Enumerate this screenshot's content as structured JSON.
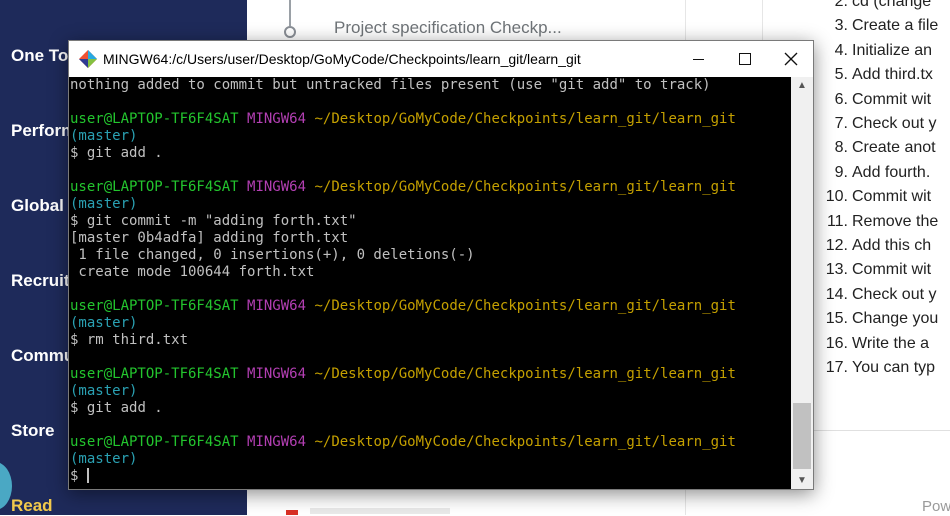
{
  "background_page": {
    "sidebar": {
      "items": [
        {
          "label": "One To"
        },
        {
          "label": "Perform"
        },
        {
          "label": "Global I"
        },
        {
          "label": "Recruite"
        },
        {
          "label": "Commu"
        },
        {
          "label": "Store"
        },
        {
          "label": "Read"
        }
      ]
    },
    "timeline": {
      "current_item": "Project specification Checkp..."
    },
    "instructions": [
      {
        "num": "2.",
        "text": "cd (change"
      },
      {
        "num": "3.",
        "text": "Create a file"
      },
      {
        "num": "4.",
        "text": "Initialize an"
      },
      {
        "num": "5.",
        "text": "Add third.tx"
      },
      {
        "num": "6.",
        "text": "Commit wit"
      },
      {
        "num": "7.",
        "text": "Check out y"
      },
      {
        "num": "8.",
        "text": "Create anot"
      },
      {
        "num": "9.",
        "text": "Add fourth."
      },
      {
        "num": "10.",
        "text": "Commit wit"
      },
      {
        "num": "11.",
        "text": "Remove the"
      },
      {
        "num": "12.",
        "text": "Add this ch"
      },
      {
        "num": "13.",
        "text": "Commit wit"
      },
      {
        "num": "14.",
        "text": "Check out y"
      },
      {
        "num": "15.",
        "text": "Change you"
      },
      {
        "num": "16.",
        "text": "Write the a"
      },
      {
        "num": "17.",
        "text": "You can typ"
      }
    ],
    "footer": {
      "powered": "Pow"
    }
  },
  "window": {
    "title": "MINGW64:/c/Users/user/Desktop/GoMyCode/Checkpoints/learn_git/learn_git",
    "icon": "git-bash-icon",
    "controls": {
      "minimize": "minimize-icon",
      "maximize": "maximize-icon",
      "close": "close-icon"
    }
  },
  "prompt": {
    "user": "user@LAPTOP-TF6F4SAT",
    "env": "MINGW64",
    "path": "~/Desktop/GoMyCode/Checkpoints/learn_git/learn_git",
    "branch": "(master)",
    "symbol": "$"
  },
  "terminal_lines": {
    "l0": "nothing added to commit but untracked files present (use \"git add\" to track)",
    "cmd1": " git add .",
    "cmd2": " git commit -m \"adding forth.txt\"",
    "out2a": "[master 0b4adfa] adding forth.txt",
    "out2b": " 1 file changed, 0 insertions(+), 0 deletions(-)",
    "out2c": " create mode 100644 forth.txt",
    "cmd3": " rm third.txt",
    "cmd4": " git add .",
    "cmd5": " "
  },
  "colors": {
    "user": "#23c52e",
    "mingw": "#b33fb3",
    "path": "#c4a000",
    "branch": "#2aa1b3",
    "sidebar_bg": "#1e2a5a",
    "read_accent": "#f2c94c"
  }
}
